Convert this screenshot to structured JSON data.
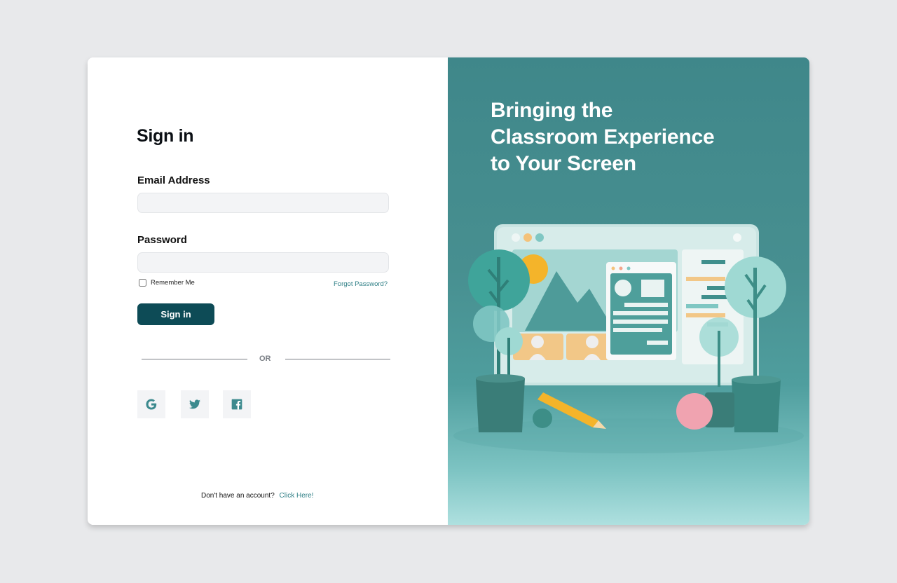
{
  "form": {
    "title": "Sign in",
    "email_label": "Email Address",
    "email_value": "",
    "password_label": "Password",
    "password_value": "",
    "remember_label": "Remember Me",
    "forgot_label": "Forgot Password?",
    "submit_label": "Sign in",
    "divider_text": "OR"
  },
  "social": [
    {
      "icon": "google-icon"
    },
    {
      "icon": "twitter-icon"
    },
    {
      "icon": "facebook-icon"
    }
  ],
  "footer": {
    "prompt": "Don't have an account?",
    "link": "Click Here!"
  },
  "hero": {
    "headline_lines": [
      "Bringing the",
      "Classroom Experience",
      "to Your Screen"
    ]
  },
  "colors": {
    "primary": "#0d4b56",
    "accent": "#2f7f86",
    "hero_bg": "#3f878a"
  }
}
